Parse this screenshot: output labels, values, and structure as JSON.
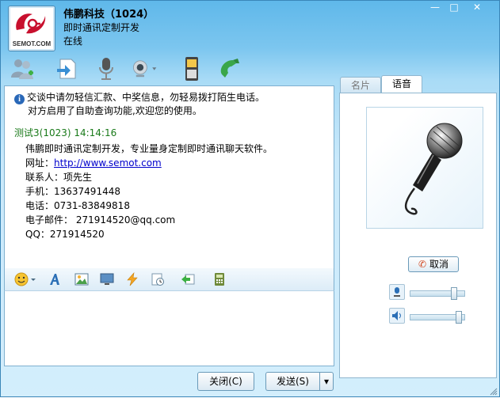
{
  "window": {
    "controls": {
      "minimize": "—",
      "maximize": "□",
      "close": "✕"
    }
  },
  "header": {
    "logo_text": "SEMOT.COM",
    "contact_name": "伟鹏科技（1024）",
    "signature": "即时通讯定制开发",
    "status": "在线"
  },
  "toolbar": {
    "icons": [
      "contacts-icon",
      "transfer-file-icon",
      "voice-mic-icon",
      "video-camera-icon",
      "mobile-phone-icon",
      "telephone-icon"
    ]
  },
  "chat": {
    "notice_line1": "交谈中请勿轻信汇款、中奖信息，勿轻易拨打陌生电话。",
    "notice_line2": "对方启用了自助查询功能,欢迎您的使用。",
    "message_header": "测试3(1023)  14:14:16",
    "message_lines": {
      "l1": "伟鹏即时通讯定制开发，专业量身定制即时通讯聊天软件。",
      "l2_label": "网址：",
      "l2_link": "http://www.semot.com",
      "l3": "联系人：项先生",
      "l4": "手机：13637491448",
      "l5": "电话：0731-83849818",
      "l6": "电子邮件： 271914520@qq.com",
      "l7": "QQ：271914520"
    }
  },
  "input_toolbar": {
    "icons": [
      "emoticon-icon",
      "font-icon",
      "image-icon",
      "screen-capture-icon",
      "shake-icon",
      "message-history-icon",
      "cut-reply-icon",
      "calculator-icon"
    ]
  },
  "buttons": {
    "close_label": "关闭(C)",
    "send_label": "发送(S)",
    "send_arrow": "▾"
  },
  "right_panel": {
    "tab_card": "名片",
    "tab_voice": "语音",
    "cancel_label": "取消",
    "mic_volume": 0.85,
    "speaker_volume": 0.95
  },
  "colors": {
    "titlebar": "#5fb8ea",
    "message_header": "#1a7a1a",
    "link": "#0000cc"
  }
}
